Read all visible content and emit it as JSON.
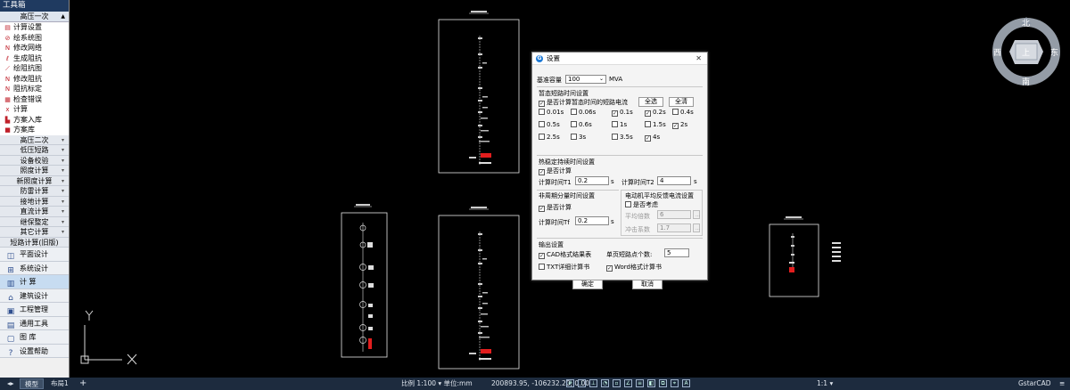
{
  "toolbox": {
    "title": "工具箱",
    "header": "高压一次",
    "items": [
      {
        "icon": "calc-settings-icon",
        "glyph": "▤",
        "label": "计算设置"
      },
      {
        "icon": "system-diagram-icon",
        "glyph": "⊘",
        "label": "绘系统图"
      },
      {
        "icon": "edit-diagram-icon",
        "glyph": "N",
        "label": "修改网络"
      },
      {
        "icon": "generate-impedance-icon",
        "glyph": "ℓ",
        "label": "生成阻抗"
      },
      {
        "icon": "draw-impedance-icon",
        "glyph": "⟋",
        "label": "绘阻抗图"
      },
      {
        "icon": "modify-impedance-icon",
        "glyph": "N",
        "label": "修改阻抗"
      },
      {
        "icon": "impedance-mark-icon",
        "glyph": "N",
        "label": "阻抗标定"
      },
      {
        "icon": "check-error-icon",
        "glyph": "▦",
        "label": "检查错误"
      },
      {
        "icon": "compute-icon",
        "glyph": "x",
        "label": "计算"
      },
      {
        "icon": "save-plan-icon",
        "glyph": "▙",
        "label": "方案入库"
      },
      {
        "icon": "plan-library-icon",
        "glyph": "■",
        "label": "方案库"
      }
    ],
    "sections": [
      "高压二次",
      "低压短路",
      "设备校验",
      "照度计算",
      "新照度计算",
      "防雷计算",
      "接地计算",
      "直流计算",
      "继保整定",
      "其它计算",
      "短路计算(旧版)"
    ],
    "modules": [
      {
        "icon": "plane-design-icon",
        "glyph": "◫",
        "label": "平面设计",
        "active": false
      },
      {
        "icon": "system-design-icon",
        "glyph": "⊞",
        "label": "系统设计",
        "active": false
      },
      {
        "icon": "calculation-icon",
        "glyph": "▥",
        "label": "计    算",
        "active": true
      },
      {
        "icon": "building-design-icon",
        "glyph": "⌂",
        "label": "建筑设计",
        "active": false
      },
      {
        "icon": "project-manage-icon",
        "glyph": "▣",
        "label": "工程管理",
        "active": false
      },
      {
        "icon": "general-tools-icon",
        "glyph": "▤",
        "label": "通用工具",
        "active": false
      },
      {
        "icon": "library-icon",
        "glyph": "▢",
        "label": "图    库",
        "active": false
      },
      {
        "icon": "settings-help-icon",
        "glyph": "?",
        "label": "设置帮助",
        "active": false
      }
    ]
  },
  "compass": {
    "north": "北",
    "south": "南",
    "east": "东",
    "west": "西",
    "center": "上"
  },
  "axes": {
    "y": "Y",
    "x": "X"
  },
  "dialog": {
    "title": "设置",
    "base_capacity_label": "基准容量",
    "base_capacity_value": "100",
    "base_capacity_unit": "MVA",
    "transient_section": "暂态短路时间设置",
    "transient_checkbox": "是否计算暂态时间的短路电流",
    "select_all": "全选",
    "clear_all": "全清",
    "times": [
      {
        "label": "0.01s",
        "checked": false
      },
      {
        "label": "0.06s",
        "checked": false
      },
      {
        "label": "0.1s",
        "checked": true
      },
      {
        "label": "0.2s",
        "checked": true
      },
      {
        "label": "0.4s",
        "checked": false
      },
      {
        "label": "0.5s",
        "checked": false
      },
      {
        "label": "0.6s",
        "checked": false
      },
      {
        "label": "1s",
        "checked": false
      },
      {
        "label": "1.5s",
        "checked": false
      },
      {
        "label": "2s",
        "checked": true
      },
      {
        "label": "2.5s",
        "checked": false
      },
      {
        "label": "3s",
        "checked": false
      },
      {
        "label": "3.5s",
        "checked": false
      },
      {
        "label": "4s",
        "checked": true
      }
    ],
    "thermal_section": "热稳定持续时间设置",
    "thermal_checkbox": "是否计算",
    "t1_label": "计算时间T1",
    "t1_value": "0.2",
    "t2_label": "计算时间T2",
    "t2_value": "4",
    "seconds_unit": "s",
    "aperiodic_section": "非周期分量时间设置",
    "aperiodic_checkbox": "是否计算",
    "tf_label": "计算时间Tf",
    "tf_value": "0.2",
    "motor_section": "电动机平均反馈电流设置",
    "motor_checkbox": "是否考虑",
    "avg_multiple_label": "平均倍数",
    "avg_multiple_value": "6",
    "impact_label": "冲击系数",
    "impact_value": "1.7",
    "output_section": "输出设置",
    "cad_result": "CAD格式结果表",
    "page_points_label": "单页短路点个数:",
    "page_points_value": "5",
    "txt_detail": "TXT详细计算书",
    "word_calc": "Word格式计算书",
    "ok": "确定",
    "cancel": "取消"
  },
  "status": {
    "tab_model": "模型",
    "tab_layout": "布局1",
    "scale": "比例 1:100 ▾ 单位:mm",
    "coords": "200893.95, -106232.20, 0.00",
    "zoom": "1:1 ▾",
    "app": "GstarCAD"
  },
  "colors": {
    "canvas": "#000000",
    "statusbar": "#1d2b3e",
    "toolbox_title": "#1f3a60",
    "highlight": "#ff2020"
  }
}
